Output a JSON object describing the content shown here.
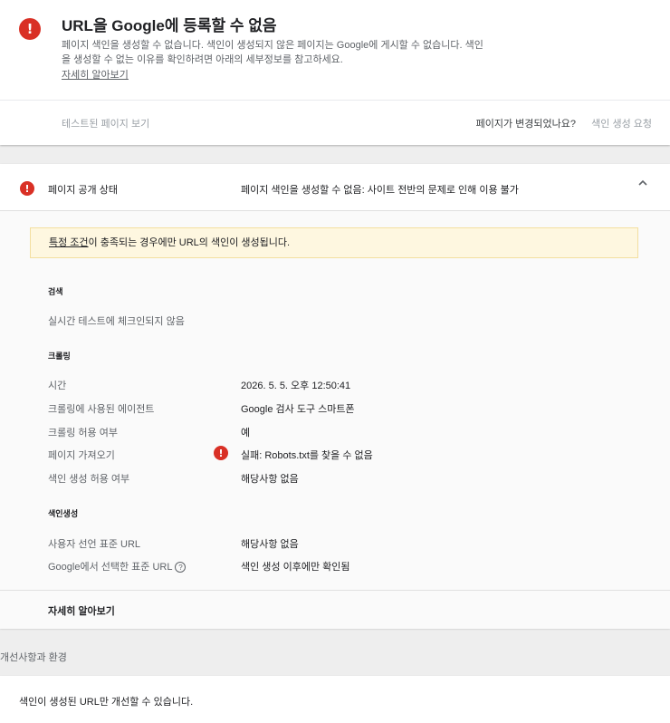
{
  "summary": {
    "title": "URL을 Google에 등록할 수 없음",
    "description": "페이지 색인을 생성할 수 없습니다. 색인이 생성되지 않은 페이지는 Google에 게시할 수 없습니다. 색인을 생성할 수 없는 이유를 확인하려면 아래의 세부정보를 참고하세요.",
    "learn_more": "자세히 알아보기",
    "view_tested_page": "테스트된 페이지 보기",
    "page_changed_question": "페이지가 변경되었나요?",
    "request_indexing": "색인 생성 요청"
  },
  "availability": {
    "label": "페이지 공개 상태",
    "status": "페이지 색인을 생성할 수 없음: 사이트 전반의 문제로 인해 이용 불가",
    "notice_link": "특정 조건",
    "notice_rest": "이 충족되는 경우에만 URL의 색인이 생성됩니다.",
    "search": {
      "title": "검색",
      "value": "실시간 테스트에 체크인되지 않음"
    },
    "crawl": {
      "title": "크롤링",
      "rows": [
        {
          "label": "시간",
          "value": "2026. 5. 5. 오후 12:50:41"
        },
        {
          "label": "크롤링에 사용된 에이전트",
          "value": "Google 검사 도구 스마트폰"
        },
        {
          "label": "크롤링 허용 여부",
          "value": "예"
        },
        {
          "label": "페이지 가져오기",
          "value": "실패: Robots.txt를 찾을 수 없음"
        },
        {
          "label": "색인 생성 허용 여부",
          "value": "해당사항 없음"
        }
      ]
    },
    "indexing": {
      "title": "색인생성",
      "rows": [
        {
          "label": "사용자 선언 표준 URL",
          "value": "해당사항 없음"
        },
        {
          "label": "Google에서 선택한 표준 URL",
          "value": "색인 생성 이후에만 확인됨"
        }
      ]
    },
    "footer_learn_more": "자세히 알아보기"
  },
  "enhancements": {
    "heading": "개선사항과 환경",
    "message": "색인이 생성된 URL만 개선할 수 있습니다."
  },
  "colors": {
    "error": "#d93025",
    "notice_bg": "#fef7e0"
  },
  "icons": {
    "error": "error-icon",
    "collapse": "chevron-up-icon",
    "help": "help-icon"
  }
}
